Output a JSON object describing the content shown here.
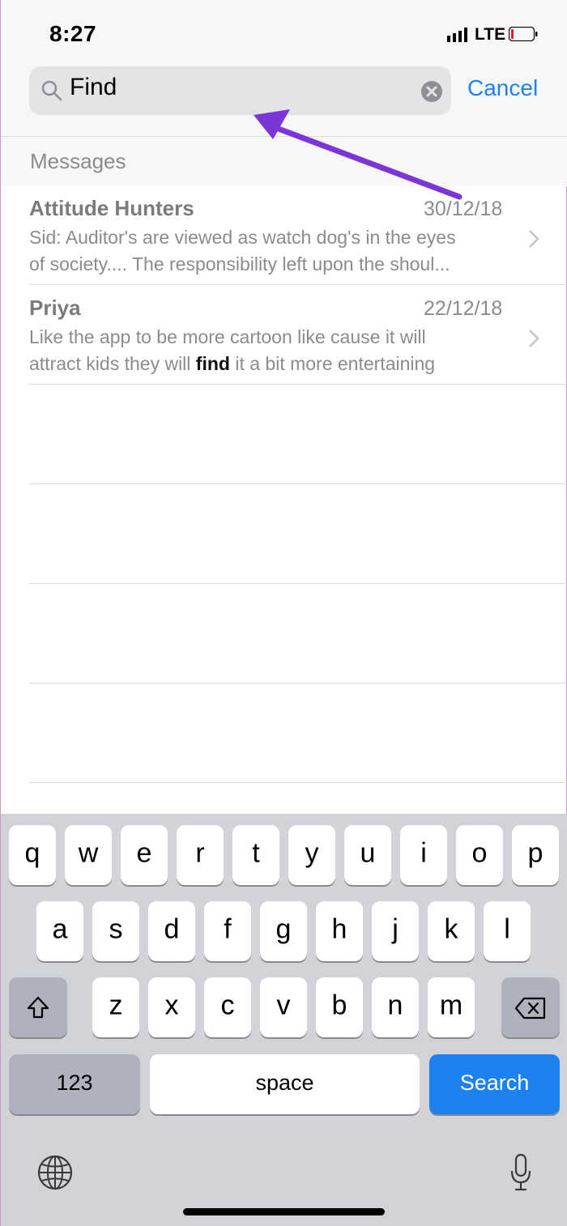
{
  "status": {
    "time": "8:27",
    "network": "LTE"
  },
  "search": {
    "query": "Find",
    "cancel_label": "Cancel"
  },
  "section": {
    "title": "Messages"
  },
  "results": [
    {
      "name": "Attitude Hunters",
      "date": "30/12/18",
      "line1": "Sid: Auditor's are viewed as watch dog's in the eyes",
      "line2": "of society.... The responsibility left upon the shoul..."
    },
    {
      "name": "Priya",
      "date": "22/12/18",
      "line1": "Like the app to be more cartoon like cause it will",
      "line2_before": "attract kids they will ",
      "line2_highlight": "find",
      "line2_after": " it a bit more entertaining"
    }
  ],
  "keyboard": {
    "row1": [
      "q",
      "w",
      "e",
      "r",
      "t",
      "y",
      "u",
      "i",
      "o",
      "p"
    ],
    "row2": [
      "a",
      "s",
      "d",
      "f",
      "g",
      "h",
      "j",
      "k",
      "l"
    ],
    "row3": [
      "z",
      "x",
      "c",
      "v",
      "b",
      "n",
      "m"
    ],
    "numbers_label": "123",
    "space_label": "space",
    "search_label": "Search"
  },
  "colors": {
    "accent": "#1b82f0",
    "annotation_arrow": "#7c35d6"
  },
  "icons": [
    "signal-icon",
    "battery-icon",
    "search-icon",
    "clear-icon",
    "chevron-right-icon",
    "shift-icon",
    "backspace-icon",
    "globe-icon",
    "microphone-icon"
  ]
}
